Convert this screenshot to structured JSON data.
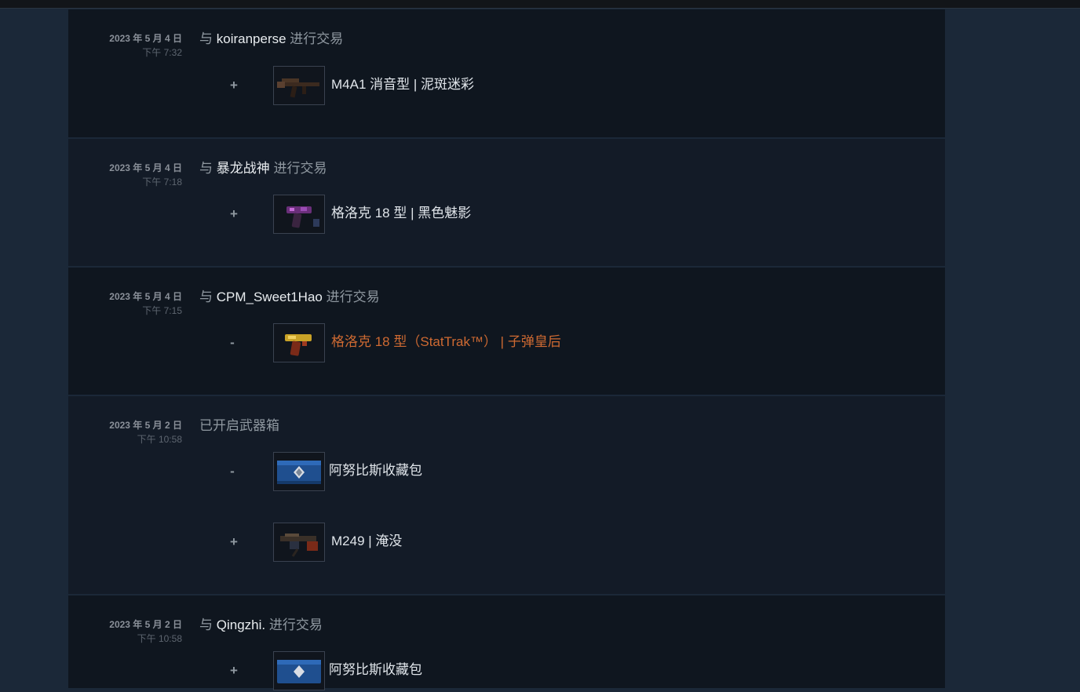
{
  "rows": [
    {
      "date": "2023 年 5 月 4 日",
      "time": "下午 7:32",
      "prefix": "与 ",
      "partner": "koiranperse",
      "suffix": " 进行交易",
      "items": [
        {
          "sign": "+",
          "name": "M4A1 消音型 | 泥斑迷彩",
          "icon": "rifle-icon"
        }
      ]
    },
    {
      "date": "2023 年 5 月 4 日",
      "time": "下午 7:18",
      "prefix": "与 ",
      "partner": "暴龙战神",
      "suffix": " 进行交易",
      "items": [
        {
          "sign": "+",
          "name": "格洛克 18 型 | 黑色魅影",
          "icon": "pistol-icon"
        }
      ]
    },
    {
      "date": "2023 年 5 月 4 日",
      "time": "下午 7:15",
      "prefix": "与 ",
      "partner": "CPM_Sweet1Hao",
      "suffix": " 进行交易",
      "items": [
        {
          "sign": "-",
          "name": "格洛克 18 型（StatTrak™） | 子弹皇后",
          "icon": "pistol-icon",
          "name_color": "#cf6a32"
        }
      ]
    },
    {
      "date": "2023 年 5 月 2 日",
      "time": "下午 10:58",
      "action": "已开启武器箱",
      "items": [
        {
          "sign": "-",
          "name": "阿努比斯收藏包",
          "icon": "case-icon"
        },
        {
          "sign": "+",
          "name": "M249 | 淹没",
          "icon": "machine-gun-icon"
        }
      ]
    },
    {
      "date": "2023 年 5 月 2 日",
      "time": "下午 10:58",
      "prefix": "与 ",
      "partner": "Qingzhi.",
      "suffix": " 进行交易",
      "items": [
        {
          "sign": "+",
          "name": "阿努比斯收藏包",
          "icon": "case-icon"
        }
      ]
    }
  ]
}
